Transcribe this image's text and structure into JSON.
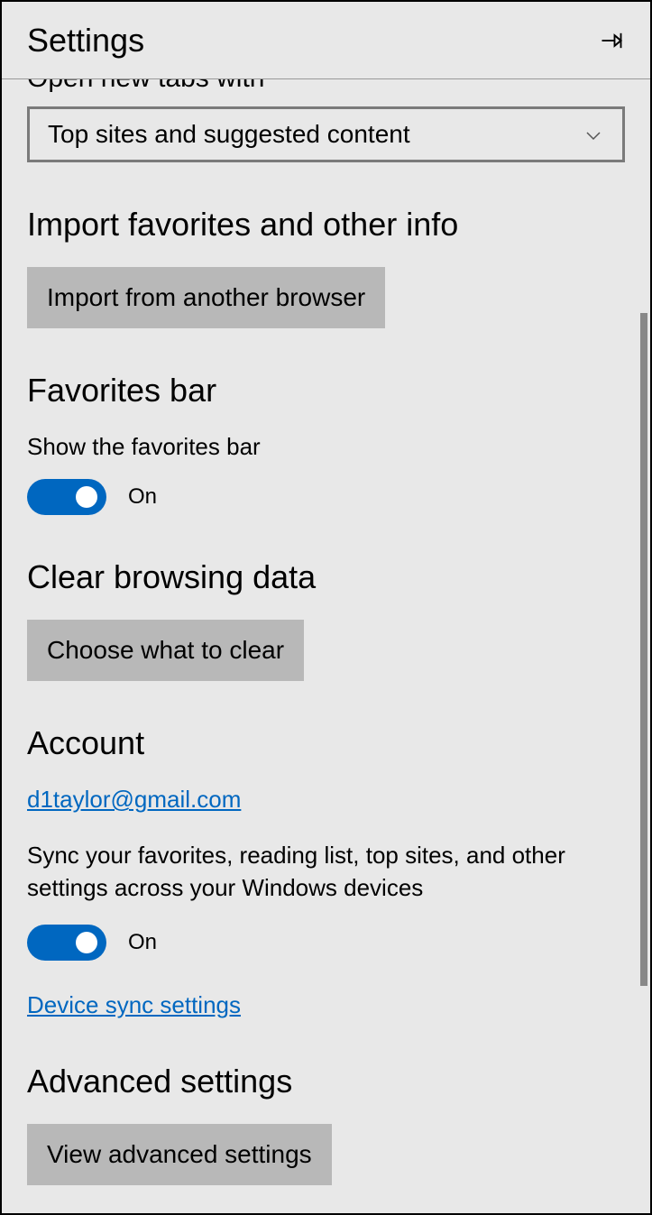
{
  "header": {
    "title": "Settings"
  },
  "newTabs": {
    "label_cutoff": "Open new tabs with",
    "selected": "Top sites and suggested content"
  },
  "importFavorites": {
    "heading": "Import favorites and other info",
    "button": "Import from another browser"
  },
  "favoritesBar": {
    "heading": "Favorites bar",
    "subLabel": "Show the favorites bar",
    "toggleState": "On"
  },
  "clearData": {
    "heading": "Clear browsing data",
    "button": "Choose what to clear"
  },
  "account": {
    "heading": "Account",
    "email": "d1taylor@gmail.com",
    "syncDescription": "Sync your favorites, reading list, top sites, and other settings across your Windows devices",
    "toggleState": "On",
    "deviceLink": "Device sync settings"
  },
  "advanced": {
    "heading": "Advanced settings",
    "button": "View advanced settings"
  }
}
